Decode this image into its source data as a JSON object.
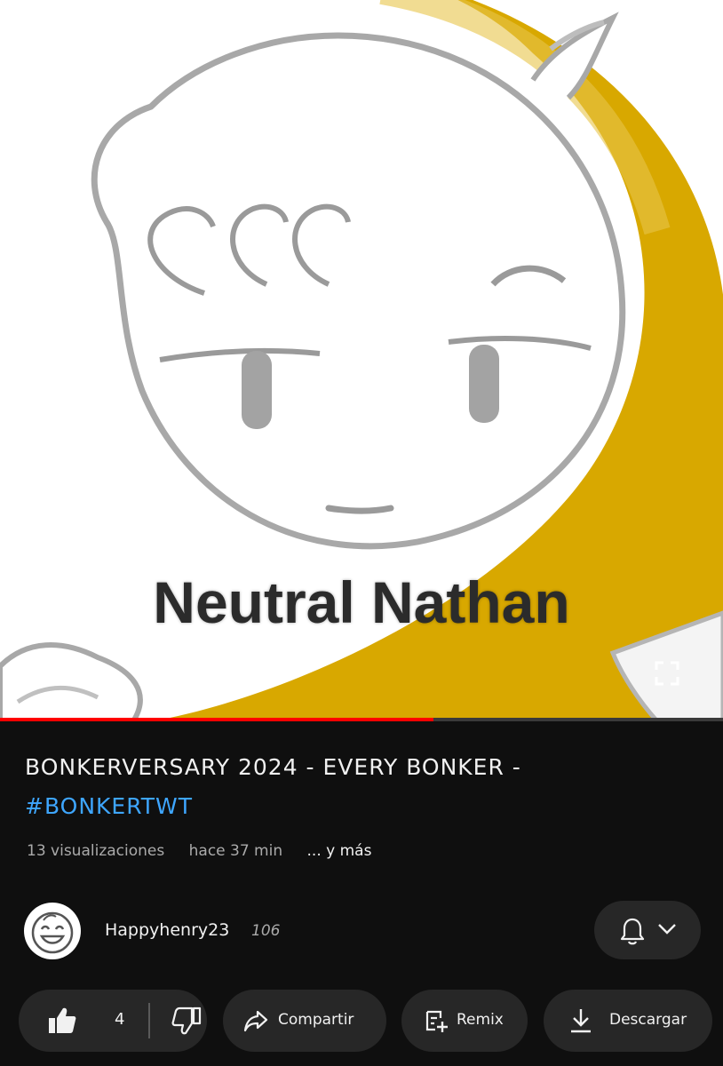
{
  "video": {
    "caption": "Neutral Nathan",
    "progress_fraction": 0.6,
    "colors": {
      "background_ring": "#d8a800",
      "face": "#ffffff",
      "outline": "#9a9a9a"
    }
  },
  "title": {
    "text": "BONKERVERSARY 2024 - EVERY BONKER -",
    "hashtag": "#BONKERTWT"
  },
  "meta": {
    "views": "13 visualizaciones",
    "time": "hace 37 min",
    "more": "... y más"
  },
  "channel": {
    "name": "Happyhenry23",
    "subscribers": "106"
  },
  "actions": {
    "like_count": "4",
    "share_label": "Compartir",
    "remix_label": "Remix",
    "download_label": "Descargar"
  },
  "icons": {
    "fullscreen": "fullscreen-icon",
    "bell": "bell-icon",
    "chevron": "chevron-down-icon",
    "like": "thumbs-up-icon",
    "dislike": "thumbs-down-icon",
    "share": "share-arrow-icon",
    "remix": "remix-icon",
    "download": "download-icon"
  }
}
